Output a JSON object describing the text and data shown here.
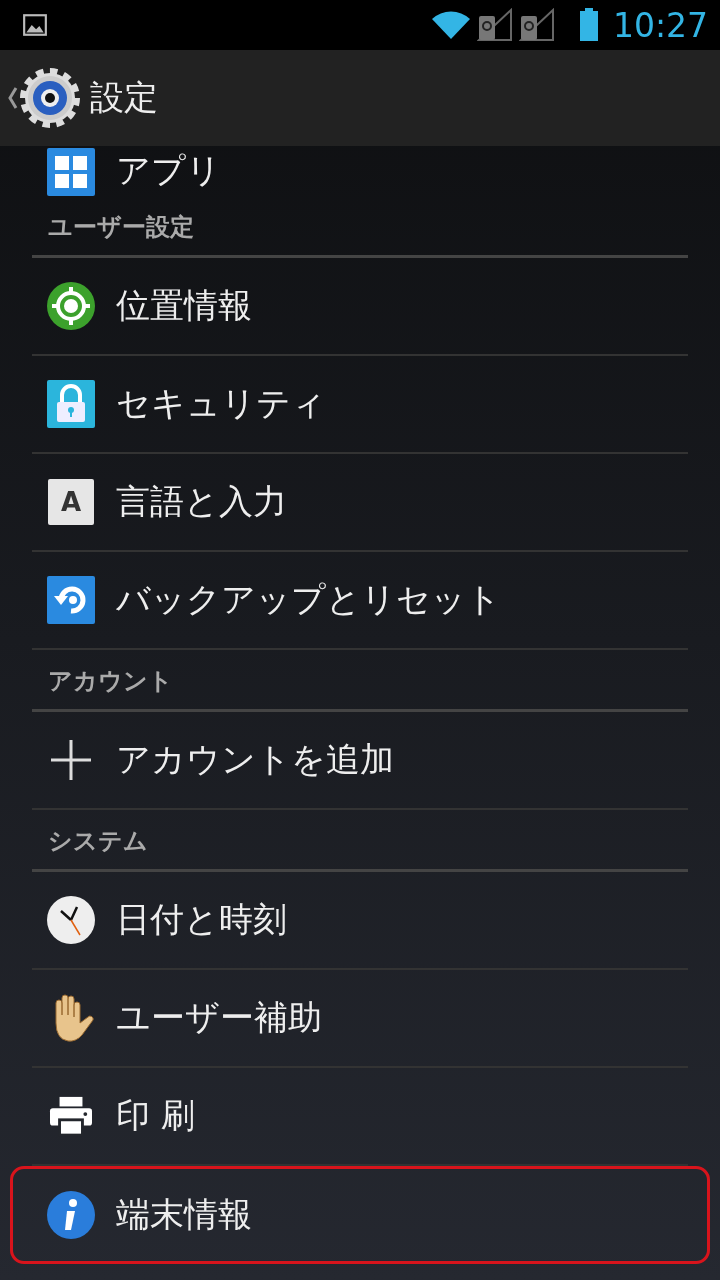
{
  "status_bar": {
    "time": "10:27"
  },
  "action_bar": {
    "title": "設定"
  },
  "sections": [
    {
      "items": [
        {
          "label": "アプリ",
          "kind": "apps",
          "highlighted": false
        }
      ]
    },
    {
      "header": "ユーザー設定",
      "items": [
        {
          "label": "位置情報",
          "kind": "location",
          "highlighted": false
        },
        {
          "label": "セキュリティ",
          "kind": "lock",
          "highlighted": false
        },
        {
          "label": "言語と入力",
          "kind": "language",
          "icon_text": "A",
          "highlighted": false
        },
        {
          "label": "バックアップとリセット",
          "kind": "backup",
          "highlighted": false
        }
      ]
    },
    {
      "header": "アカウント",
      "items": [
        {
          "label": "アカウントを追加",
          "kind": "add",
          "highlighted": false
        }
      ]
    },
    {
      "header": "システム",
      "items": [
        {
          "label": "日付と時刻",
          "kind": "clock",
          "highlighted": false
        },
        {
          "label": "ユーザー補助",
          "kind": "hand",
          "highlighted": false
        },
        {
          "label": "印 刷",
          "kind": "print",
          "highlighted": false
        },
        {
          "label": "端末情報",
          "kind": "info",
          "highlighted": true
        }
      ]
    }
  ]
}
